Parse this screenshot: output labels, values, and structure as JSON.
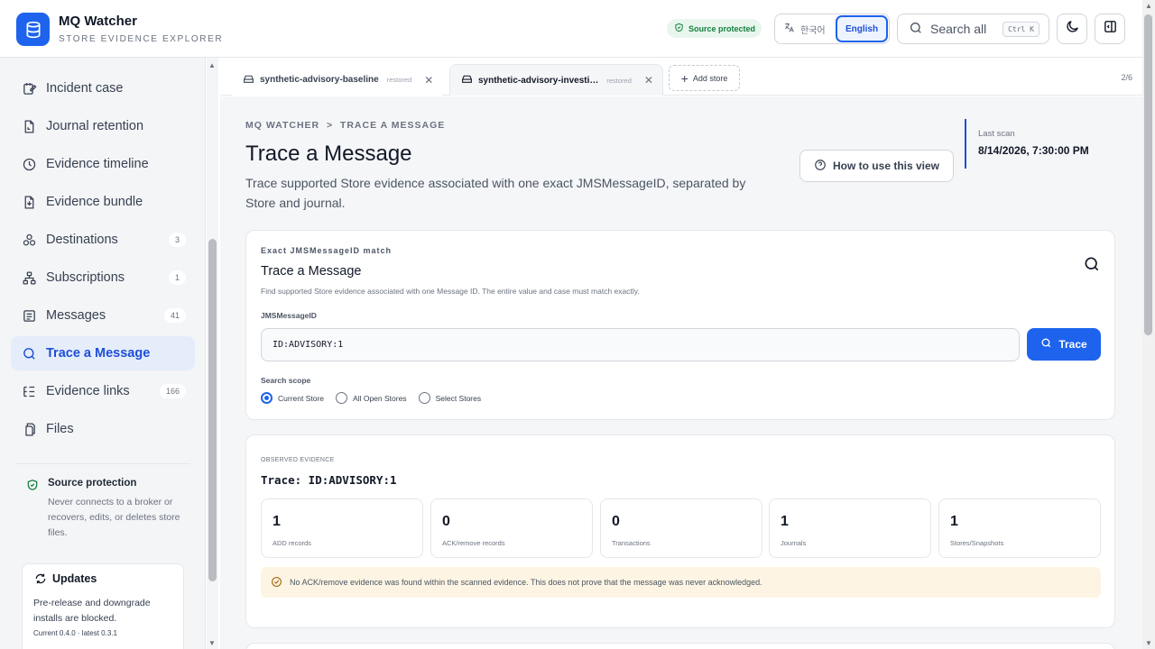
{
  "app": {
    "title": "MQ Watcher",
    "subtitle": "STORE EVIDENCE EXPLORER",
    "brand_color": "#1d63ed"
  },
  "header": {
    "source_badge": "Source protected",
    "lang_ko": "한국어",
    "lang_en": "English",
    "search_label": "Search all",
    "search_shortcut": "Ctrl K"
  },
  "sidebar": {
    "items": [
      {
        "label": "Incident case",
        "icon": "case-edit-icon"
      },
      {
        "label": "Journal retention",
        "icon": "file-retention-icon"
      },
      {
        "label": "Evidence timeline",
        "icon": "clock-icon"
      },
      {
        "label": "Evidence bundle",
        "icon": "file-download-icon"
      },
      {
        "label": "Destinations",
        "count": "3",
        "icon": "destinations-icon"
      },
      {
        "label": "Subscriptions",
        "count": "1",
        "icon": "network-icon"
      },
      {
        "label": "Messages",
        "count": "41",
        "icon": "message-icon"
      },
      {
        "label": "Trace a Message",
        "icon": "search-icon",
        "active": true
      },
      {
        "label": "Evidence links",
        "count": "166",
        "icon": "list-tree-icon"
      },
      {
        "label": "Files",
        "icon": "files-icon"
      }
    ],
    "protection": {
      "title": "Source protection",
      "text": "Never connects to a broker or recovers, edits, or deletes store files."
    },
    "updates": {
      "title": "Updates",
      "text": "Pre-release and downgrade installs are blocked.",
      "version": "Current 0.4.0 · latest 0.3.1"
    }
  },
  "tabs": {
    "items": [
      {
        "label": "synthetic-advisory-baseline",
        "status": "restored"
      },
      {
        "label": "synthetic-advisory-investi…",
        "status": "restored"
      }
    ],
    "add_label": "Add store",
    "count": "2/6"
  },
  "page": {
    "breadcrumb": "MQ WATCHER  >  TRACE A MESSAGE",
    "title": "Trace a Message",
    "description": "Trace supported Store evidence associated with one exact JMSMessageID, separated by Store and journal.",
    "howto_label": "How to use this view",
    "scan_label": "Last scan",
    "scan_value": "8/14/2026, 7:30:00 PM"
  },
  "search_card": {
    "eyebrow": "Exact JMSMessageID match",
    "title": "Trace a Message",
    "description": "Find supported Store evidence associated with one Message ID. The entire value and case must match exactly.",
    "field_label": "JMSMessageID",
    "field_value": "ID:ADVISORY:1",
    "button_label": "Trace",
    "scope_label": "Search scope",
    "scope_options": [
      "Current Store",
      "All Open Stores",
      "Select Stores"
    ],
    "scope_selected": "Current Store"
  },
  "result_card": {
    "eyebrow": "OBSERVED EVIDENCE",
    "title": "Trace: ID:ADVISORY:1",
    "stats": [
      {
        "value": "1",
        "label": "ADD records"
      },
      {
        "value": "0",
        "label": "ACK/remove records"
      },
      {
        "value": "0",
        "label": "Transactions"
      },
      {
        "value": "1",
        "label": "Journals"
      },
      {
        "value": "1",
        "label": "Stores/Snapshots"
      }
    ],
    "notice": "No ACK/remove evidence was found within the scanned evidence. This does not prove that the message was never acknowledged."
  }
}
